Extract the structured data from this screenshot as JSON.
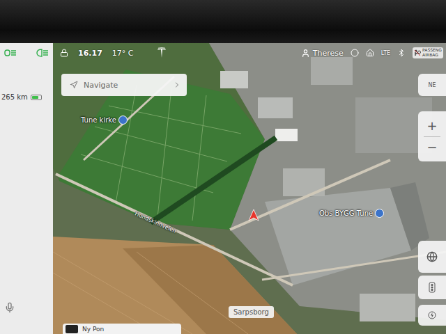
{
  "status_bar": {
    "time": "16.17",
    "temperature": "17° C",
    "driver": "Therese",
    "network": "LTE",
    "airbag": [
      "PASSENG",
      "AIRBAG"
    ]
  },
  "vehicle": {
    "range": "265 km",
    "battery_level": 0.78
  },
  "navigate": {
    "placeholder": "Navigate"
  },
  "map": {
    "labels": [
      {
        "text": "Tune kirke",
        "kind": "poi"
      },
      {
        "text": "Obs BYGG Tune",
        "kind": "poi"
      },
      {
        "text": "Hundskinnveien",
        "kind": "road"
      }
    ],
    "city": "Sarpsborg",
    "compass": "NE"
  },
  "zoom": {
    "in": "+",
    "out": "−"
  },
  "media": {
    "title": "Ny Pon"
  }
}
